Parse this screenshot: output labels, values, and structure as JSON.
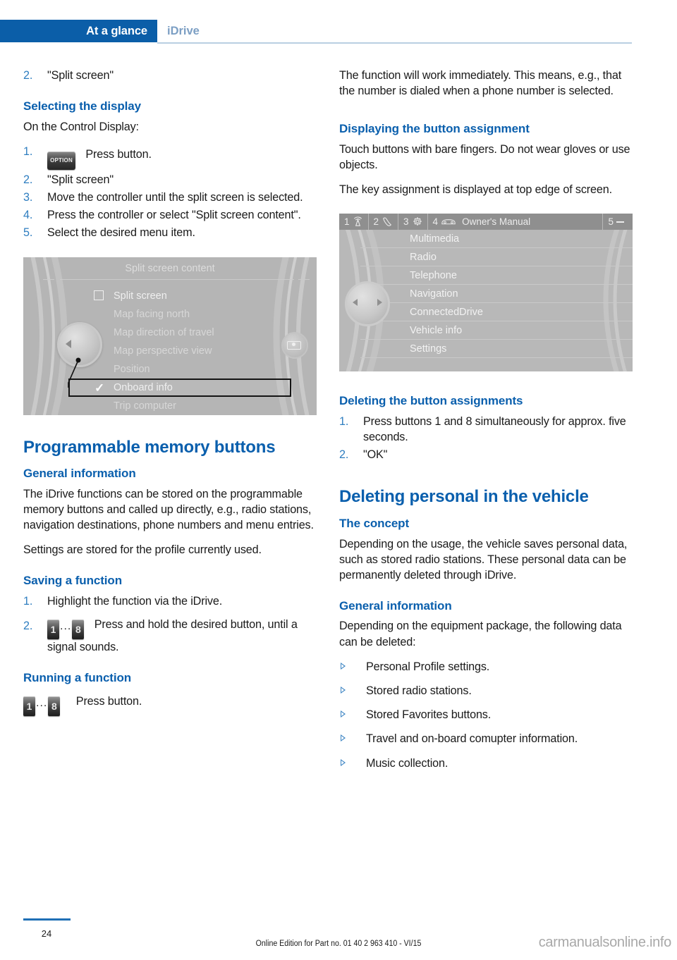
{
  "header": {
    "active_tab": "At a glance",
    "sub_tab": "iDrive"
  },
  "left_column": {
    "step_top": {
      "num": "2.",
      "text": "\"Split screen\""
    },
    "heading_selecting_display": "Selecting the display",
    "intro": "On the Control Display:",
    "steps": [
      {
        "num": "1.",
        "icon": "OPTION",
        "text": "Press button."
      },
      {
        "num": "2.",
        "text": "\"Split screen\""
      },
      {
        "num": "3.",
        "text": "Move the controller until the split screen is selected."
      },
      {
        "num": "4.",
        "text": "Press the controller or select \"Split screen content\"."
      },
      {
        "num": "5.",
        "text": "Select the desired menu item."
      }
    ],
    "figure_split_screen": {
      "title": "Split screen content",
      "items": [
        {
          "label": "Split screen",
          "mark": "checkbox"
        },
        {
          "label": "Map facing north",
          "mark": "none"
        },
        {
          "label": "Map direction of travel",
          "mark": "none"
        },
        {
          "label": "Map perspective view",
          "mark": "none"
        },
        {
          "label": "Position",
          "mark": "none"
        },
        {
          "label": "Onboard info",
          "mark": "check",
          "highlighted": true
        },
        {
          "label": "Trip computer",
          "mark": "none"
        }
      ]
    },
    "heading_programmable": "Programmable memory buttons",
    "heading_general_info": "General information",
    "general_info_p1": "The iDrive functions can be stored on the programmable memory buttons and called up directly, e.g., radio stations, navigation destinations, phone numbers and menu entries.",
    "general_info_p2": "Settings are stored for the profile currently used.",
    "heading_saving": "Saving a function",
    "saving_steps": [
      {
        "num": "1.",
        "text": "Highlight the function via the iDrive."
      },
      {
        "num": "2.",
        "key_from": "1",
        "key_dots": "...",
        "key_to": "8",
        "text": "Press and hold the desired button, until a signal sounds."
      }
    ],
    "heading_running": "Running a function",
    "running": {
      "key_from": "1",
      "key_dots": "...",
      "key_to": "8",
      "text": "Press button."
    }
  },
  "right_column": {
    "p_function_works": "The function will work immediately. This means, e.g., that the number is dialed when a phone number is selected.",
    "heading_displaying": "Displaying the button assignment",
    "p_touch_buttons": "Touch buttons with bare fingers. Do not wear gloves or use objects.",
    "p_key_assignment": "The key assignment is displayed at top edge of screen.",
    "figure_menu": {
      "toolbar": [
        {
          "num": "1",
          "icon": "antenna-icon"
        },
        {
          "num": "2",
          "icon": "phone-handset-icon"
        },
        {
          "num": "3",
          "icon": "gear-icon"
        },
        {
          "num": "4",
          "icon": "car-icon",
          "label": "Owner's Manual"
        },
        {
          "num": "5",
          "icon": "dash-icon"
        }
      ],
      "items": [
        "Multimedia",
        "Radio",
        "Telephone",
        "Navigation",
        "ConnectedDrive",
        "Vehicle info",
        "Settings"
      ]
    },
    "heading_deleting_assignments": "Deleting the button assignments",
    "deleting_steps": [
      {
        "num": "1.",
        "text": "Press buttons 1 and 8 simultaneously for approx. five seconds."
      },
      {
        "num": "2.",
        "text": "\"OK\""
      }
    ],
    "heading_deleting_personal": "Deleting personal in the vehicle",
    "heading_concept": "The concept",
    "p_concept": "Depending on the usage, the vehicle saves personal data, such as stored radio stations. These personal data can be permanently deleted through iDrive.",
    "heading_general_info2": "General information",
    "p_general2": "Depending on the equipment package, the following data can be deleted:",
    "bullets": [
      "Personal Profile settings.",
      "Stored radio stations.",
      "Stored Favorites buttons.",
      "Travel and on-board comupter information.",
      "Music collection."
    ]
  },
  "footer": {
    "page_number": "24",
    "edition": "Online Edition for Part no. 01 40 2 963 410 - VI/15",
    "watermark": "carmanualsonline.info"
  },
  "colors": {
    "brand_blue": "#0b5ea8",
    "heading_blue": "#0a5fad",
    "tab_inactive": "#7c9fc4",
    "list_number": "#2f7ec0"
  }
}
